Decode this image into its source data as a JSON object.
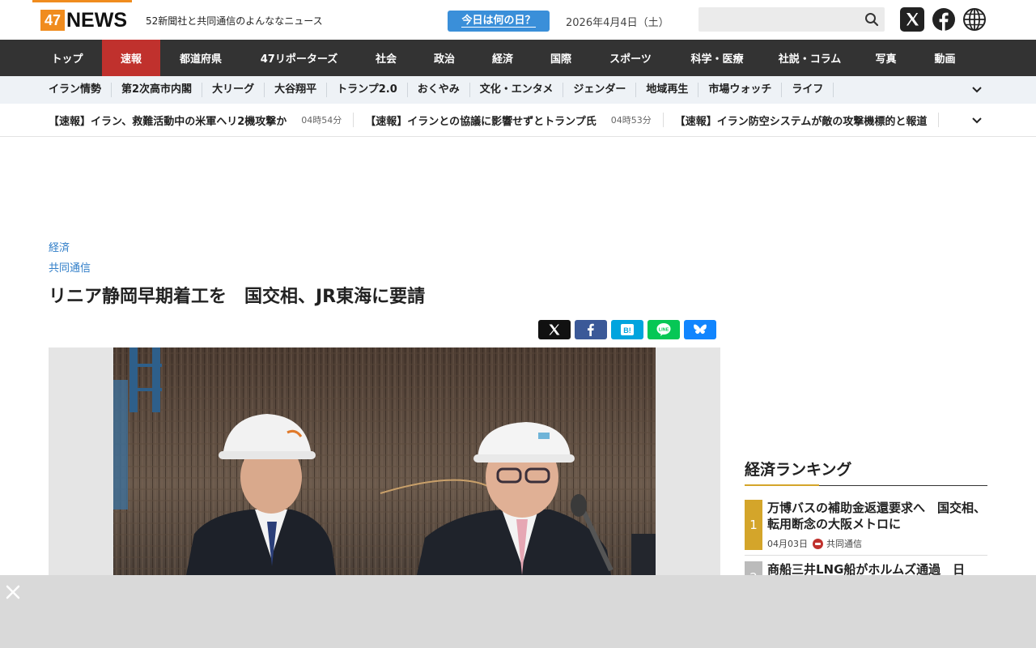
{
  "header": {
    "logo_num": "47",
    "logo_word": "NEWS",
    "tagline": "52新聞社と共同通信のよんななニュース",
    "today_button": "今日は何の日？",
    "date": "2026年4月4日（土）",
    "search_placeholder": ""
  },
  "main_nav": {
    "items": [
      {
        "label": "トップ",
        "w": 86
      },
      {
        "label": "速報",
        "w": 72
      },
      {
        "label": "都道府県",
        "w": 100
      },
      {
        "label": "47リポーターズ",
        "w": 143
      },
      {
        "label": "社会",
        "w": 72
      },
      {
        "label": "政治",
        "w": 72
      },
      {
        "label": "経済",
        "w": 72
      },
      {
        "label": "国際",
        "w": 72
      },
      {
        "label": "スポーツ",
        "w": 100
      },
      {
        "label": "科学・医療",
        "w": 114
      },
      {
        "label": "社説・コラム",
        "w": 115
      },
      {
        "label": "写真",
        "w": 73
      },
      {
        "label": "動画",
        "w": 73
      }
    ],
    "active": "速報"
  },
  "sub_nav": {
    "items": [
      "イラン情勢",
      "第2次高市内閣",
      "大リーグ",
      "大谷翔平",
      "トランプ2.0",
      "おくやみ",
      "文化・エンタメ",
      "ジェンダー",
      "地域再生",
      "市場ウォッチ",
      "ライフ"
    ]
  },
  "ticker": {
    "items": [
      {
        "title": "【速報】イラン、救難活動中の米軍ヘリ2機攻撃か",
        "time": "04時54分"
      },
      {
        "title": "【速報】イランとの協議に影響せずとトランプ氏",
        "time": "04時53分"
      },
      {
        "title": "【速報】イラン防空システムが敵の攻撃機標的と報道",
        "time": ""
      }
    ]
  },
  "article": {
    "category": "経済",
    "source": "共同通信",
    "headline": "リニア静岡早期着工を　国交相、JR東海に要請"
  },
  "share": {
    "icons": [
      "x-icon",
      "facebook-icon",
      "hatena-bookmark-icon",
      "line-icon",
      "bluesky-icon"
    ],
    "colors": {
      "x": "#111111",
      "facebook": "#3b5998",
      "hatena": "#00a4de",
      "line": "#06c755",
      "bluesky": "#1185fe"
    }
  },
  "ranking": {
    "title": "経済ランキング",
    "items": [
      {
        "rank": "1",
        "title": "万博バスの補助金返還要求へ　国交相、転用断念の大阪メトロに",
        "date": "04月03日",
        "source": "共同通信",
        "color": "#d4a52a"
      },
      {
        "rank": "2",
        "title": "商船三井LNG船がホルムズ通過　日",
        "date": "",
        "source": "",
        "color": "#bbbbbb"
      }
    ]
  },
  "colors": {
    "accent_orange": "#f08c1e",
    "nav_dark": "#333333",
    "nav_active_red": "#c0312d",
    "link_blue": "#2f7dc8",
    "today_blue": "#3a8fd9"
  }
}
